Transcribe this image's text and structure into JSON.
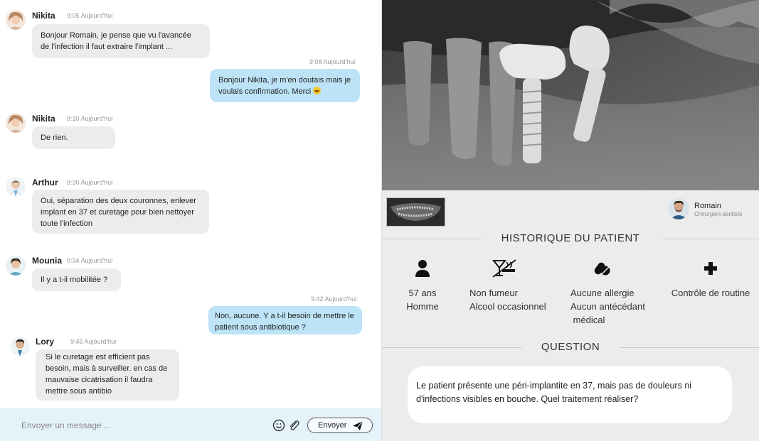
{
  "chat": {
    "messages": [
      {
        "sender": "Nikita",
        "time": "9:05 Aujourd'hui",
        "text": "Bonjour Romain, je pense que vu l'avancée de l'infection il faut extraire l'implant ..."
      },
      {
        "time": "9:08 Aujourd'hui",
        "text": "Bonjour Nikita, je m'en doutais mais je voulais confirmation. Merci"
      },
      {
        "sender": "Nikita",
        "time": "9:10 Aujourd'hui",
        "text": "De rien."
      },
      {
        "sender": "Arthur",
        "time": "9:30 Aujourd'hui",
        "text": "Oui, séparation des deux couronnes, enlever implant en 37 et curetage pour bien nettoyer toute l'infection"
      },
      {
        "sender": "Mounia",
        "time": "9:34 Aujourd'hui",
        "text": "Il y a t-il mobilitée ?"
      },
      {
        "time": "9:42 Aujourd'hui",
        "text": "Non, aucune. Y a t-il besoin de mettre le patient sous antibiotique ?"
      },
      {
        "sender": "Lory",
        "time": "9:45 Aujourd'hui",
        "text": "Si le curetage est efficient pas besoin, mais à surveiller. en cas de mauvaise cicatrisation il faudra mettre sous antibio"
      }
    ],
    "composer": {
      "placeholder": "Envoyer un message ...",
      "send_label": "Envoyer",
      "emoji_icon": "smiley-icon",
      "attach_icon": "paperclip-icon",
      "send_icon": "paper-plane-icon"
    }
  },
  "patient": {
    "doctor": {
      "name": "Romain",
      "role": "Chirurgien-dentiste"
    },
    "history_title": "HISTORIQUE DU PATIENT",
    "history": [
      {
        "icon": "person-icon",
        "lines": [
          "57 ans",
          "Homme"
        ]
      },
      {
        "icon": "no-smoking-alcohol-icon",
        "lines": [
          "Non fumeur",
          "Alcool occasionnel"
        ]
      },
      {
        "icon": "pills-icon",
        "lines": [
          "Aucune allergie",
          "Aucun antécédant",
          " médical"
        ]
      },
      {
        "icon": "medical-cross-icon",
        "lines": [
          "Contrôle de routine"
        ]
      }
    ],
    "question_title": "QUESTION",
    "question": "Le patient présente une péri-implantite en 37, mais pas de douleurs ni d'infections visibles en bouche. Quel traitement réaliser?"
  },
  "colors": {
    "outgoing_bubble": "#bde3f7",
    "incoming_bubble": "#ececec",
    "composer_bg": "#e4f2fa",
    "panel_bg": "#ececec"
  }
}
